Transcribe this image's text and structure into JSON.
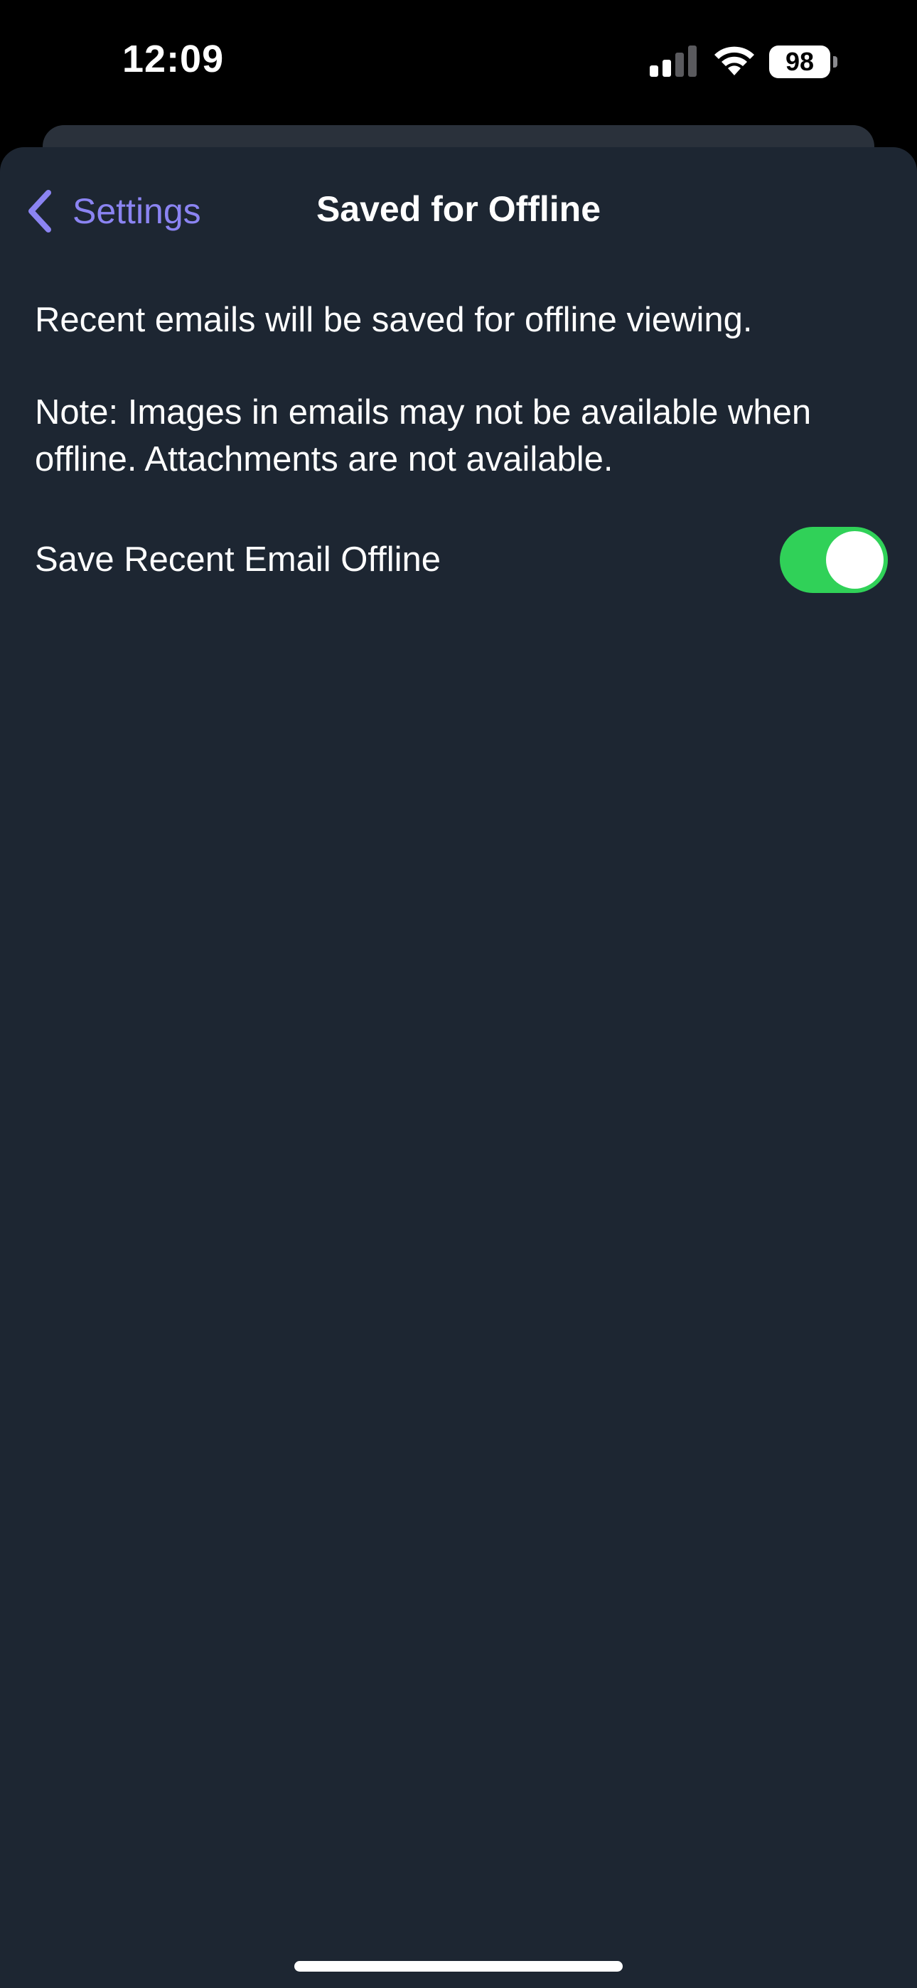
{
  "status_bar": {
    "time": "12:09",
    "battery_level": "98",
    "signal_bars_filled": 2,
    "signal_bars_total": 4,
    "icons": [
      "signal-icon",
      "wifi-icon",
      "battery-icon"
    ]
  },
  "nav": {
    "back_label": "Settings",
    "back_icon": "chevron-left-icon",
    "title": "Saved for Offline"
  },
  "content": {
    "description": "Recent emails will be saved for offline viewing.",
    "note": "Note: Images in emails may not be available when offline. Attachments are not available."
  },
  "setting": {
    "label": "Save Recent Email Offline",
    "enabled": true
  },
  "colors": {
    "background": "#1d2632",
    "accent": "#8b84f2",
    "toggle_on": "#30d158",
    "status_bar": "#000000"
  }
}
